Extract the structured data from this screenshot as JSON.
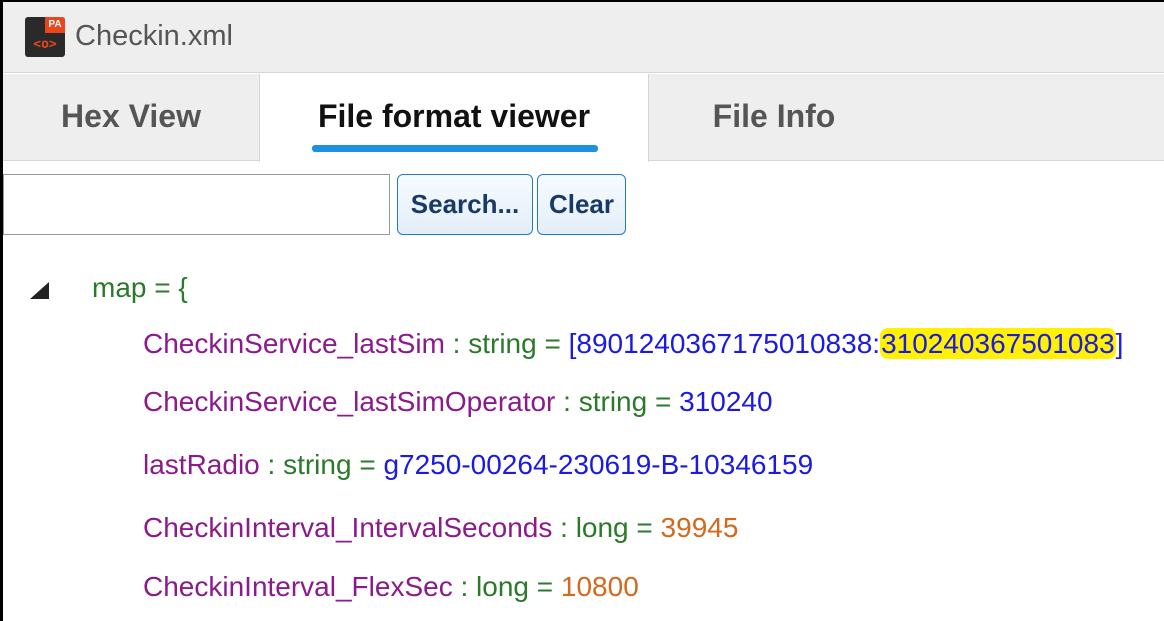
{
  "window": {
    "title": "Checkin.xml",
    "icon_badge": "PA",
    "icon_glyph": "<o>"
  },
  "tabs": [
    {
      "label": "Hex View",
      "active": false
    },
    {
      "label": "File format viewer",
      "active": true
    },
    {
      "label": "File Info",
      "active": false
    }
  ],
  "search": {
    "value": "",
    "search_label": "Search...",
    "clear_label": "Clear"
  },
  "tree": {
    "root": "map = {",
    "entries": [
      {
        "key": "CheckinService_lastSim",
        "type": "string",
        "value_prefix": "[8901240367175010838:",
        "value_highlight": "310240367501083",
        "value_suffix": "]"
      },
      {
        "key": "CheckinService_lastSimOperator",
        "type": "string",
        "value": "310240"
      },
      {
        "key": "lastRadio",
        "type": "string",
        "value": "g7250-00264-230619-B-10346159"
      },
      {
        "key": "CheckinInterval_IntervalSeconds",
        "type": "long",
        "value": "39945"
      },
      {
        "key": "CheckinInterval_FlexSec",
        "type": "long",
        "value": "10800"
      }
    ]
  },
  "colors": {
    "tab_underline": "#1e90dc",
    "key": "#8b1a8b",
    "type": "#2a7a2a",
    "string_value": "#1a1ae0",
    "number_value": "#d2691e",
    "highlight": "#fff100"
  }
}
